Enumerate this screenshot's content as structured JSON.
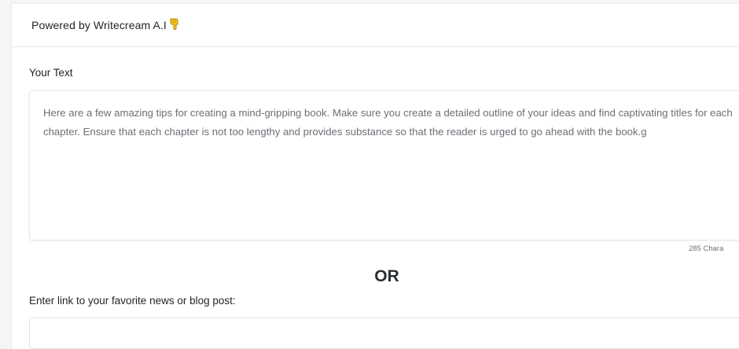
{
  "header": {
    "powered_by": "Powered by Writecream A.I"
  },
  "your_text": {
    "label": "Your Text",
    "value": "Here are a few amazing tips for creating a mind-gripping book. Make sure you create a detailed outline of your ideas and find captivating titles for each chapter. Ensure that each chapter is not too lengthy and provides substance so that the reader is urged to go ahead with the book.g",
    "char_count": "285 Chara"
  },
  "divider": {
    "or": "OR"
  },
  "link": {
    "label": "Enter link to your favorite news or blog post:",
    "value": ""
  },
  "icons": {
    "hand": "pointing-down-hand-icon"
  },
  "colors": {
    "background": "#f4f5f7",
    "card": "#ffffff",
    "text_muted": "#6b6f75",
    "hand_yellow": "#f5c518"
  }
}
